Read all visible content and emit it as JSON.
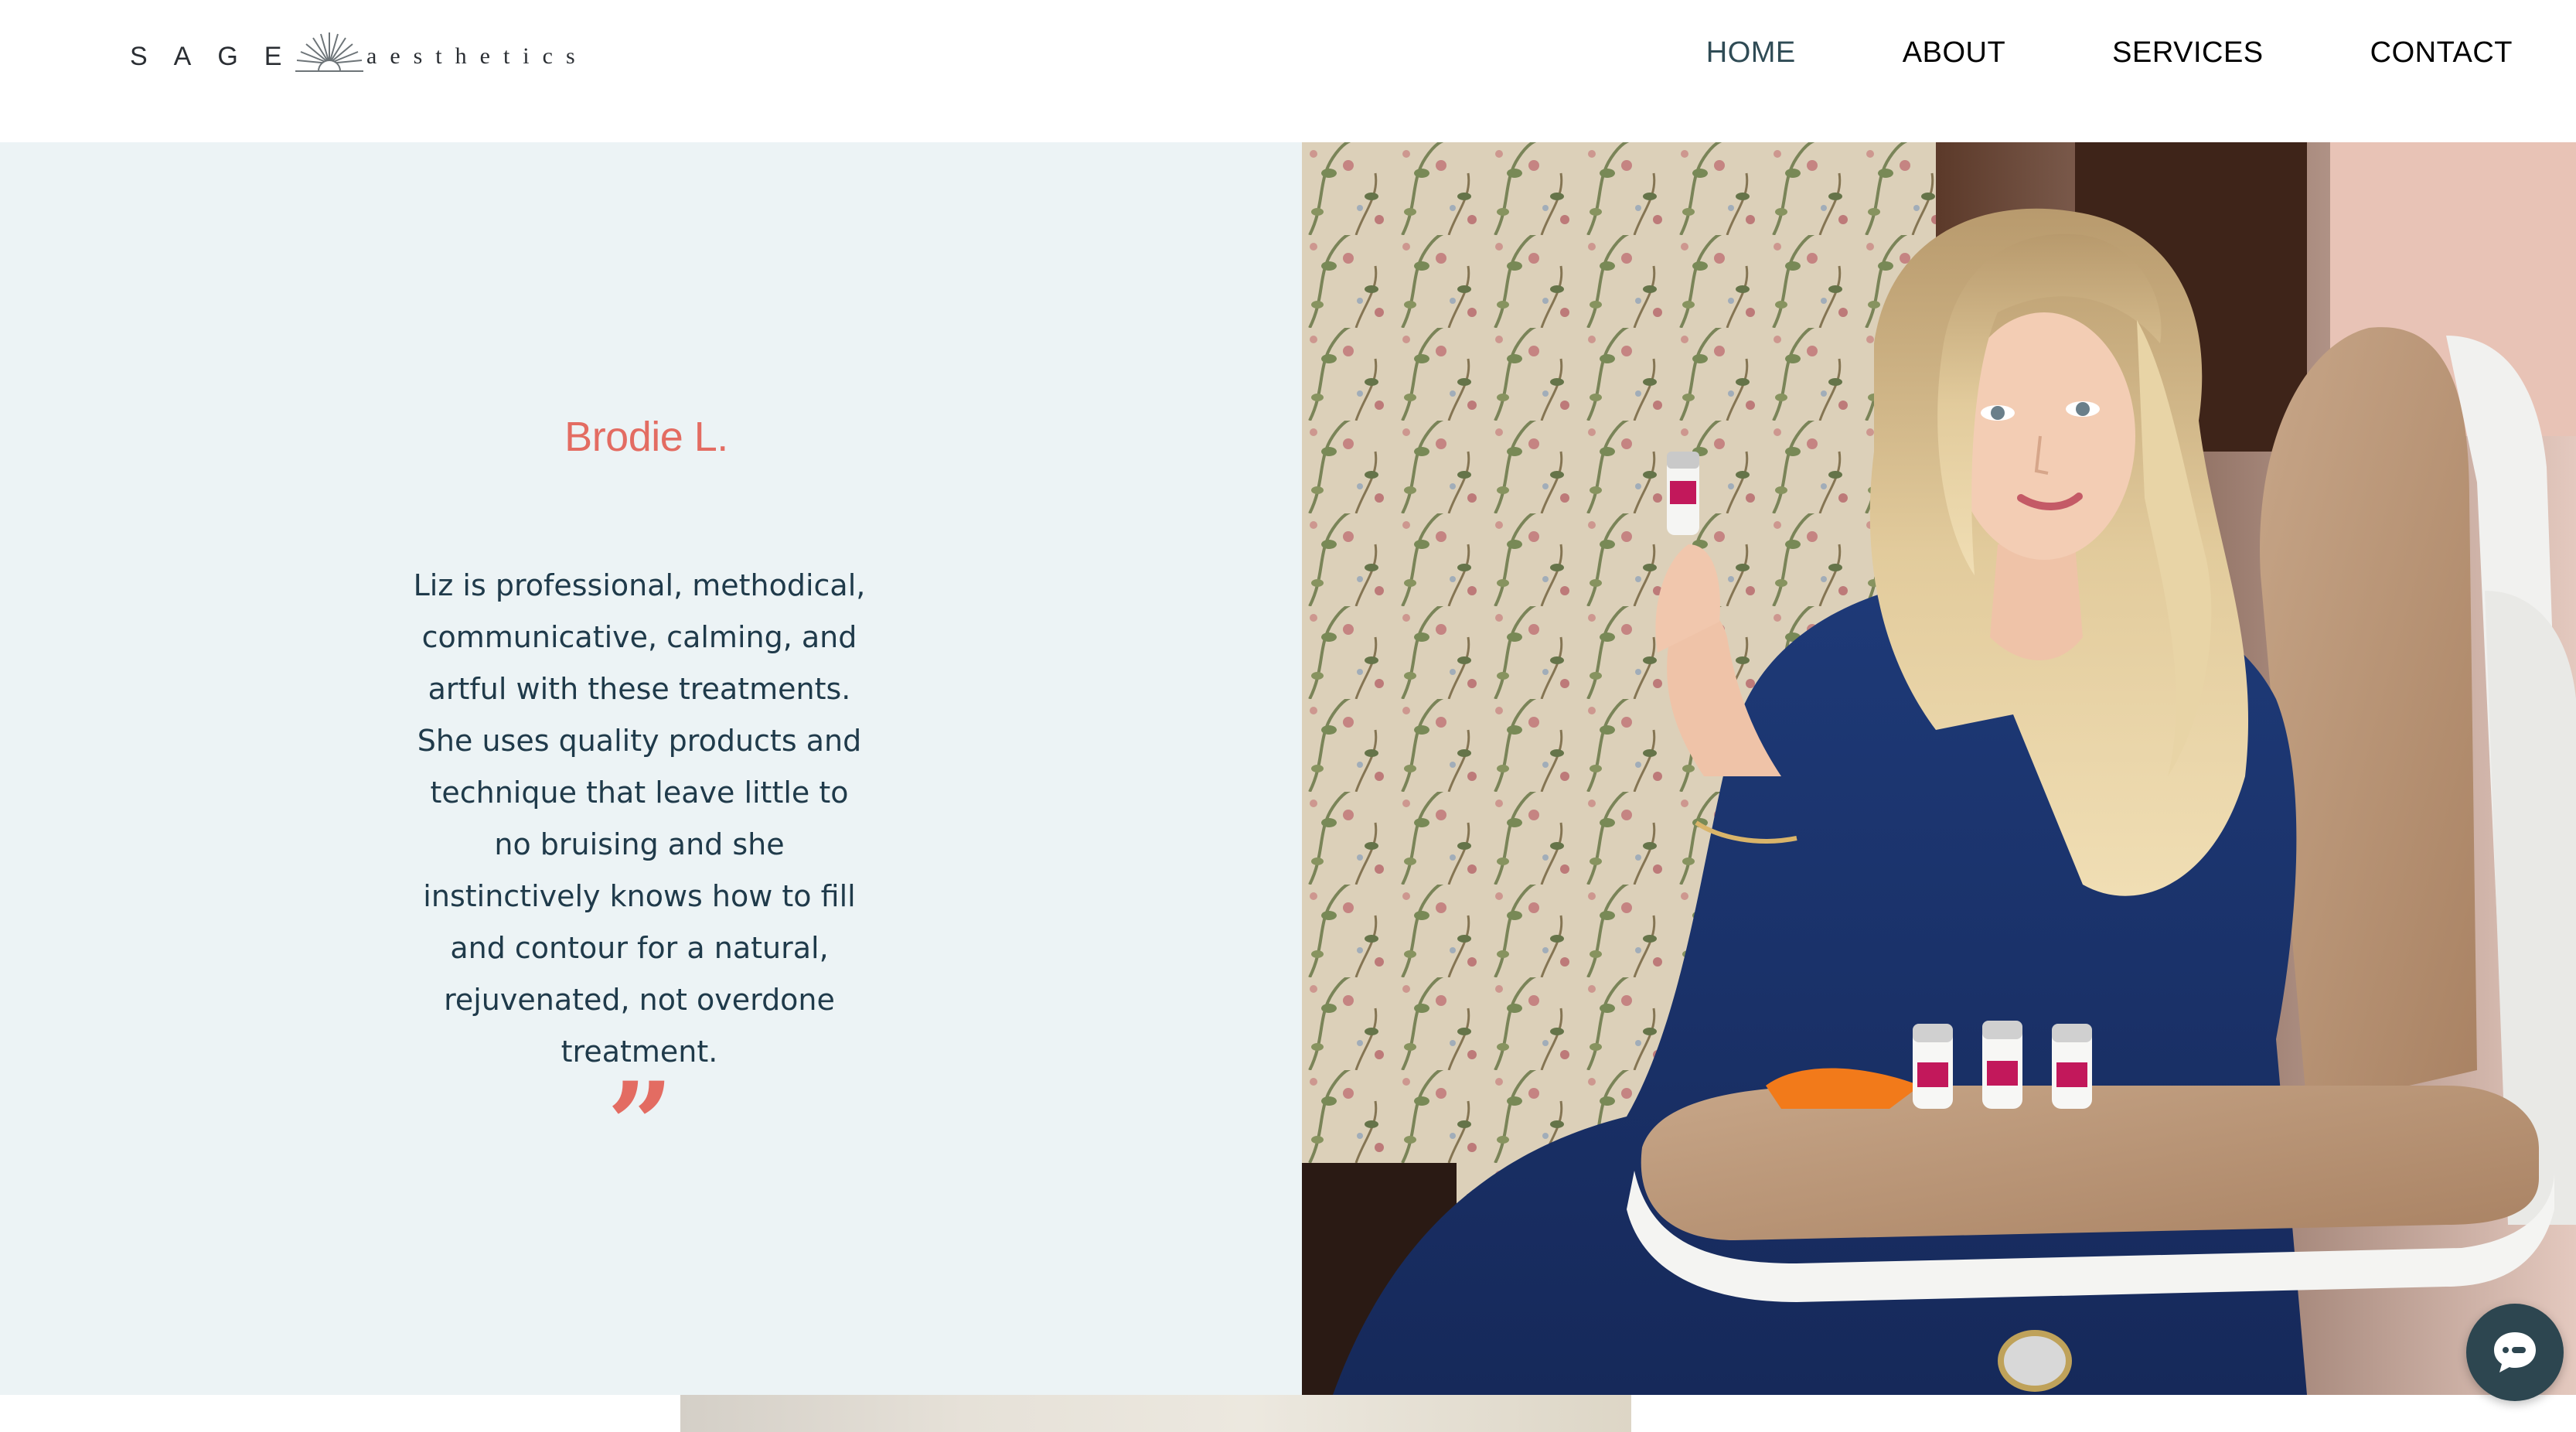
{
  "header": {
    "logo": {
      "word_left": "SAGE",
      "word_right": "aesthetics"
    },
    "nav": [
      {
        "label": "HOME",
        "active": true
      },
      {
        "label": "ABOUT",
        "active": false
      },
      {
        "label": "SERVICES",
        "active": false
      },
      {
        "label": "CONTACT",
        "active": false
      }
    ]
  },
  "testimonial": {
    "reviewer": "Brodie L.",
    "quote_lines": [
      "Liz is professional, methodical,",
      "communicative, calming, and",
      "artful with these treatments.",
      "She uses quality products and",
      "technique that leave little to",
      "no bruising and she",
      "instinctively knows how to fill",
      "and contour for a natural,",
      "rejuvenated, not overdone",
      "treatment."
    ],
    "quote_mark": "”"
  },
  "hero_photo": {
    "icon": "photo-practitioner-holding-vial"
  },
  "chat": {
    "icon": "chat-bubble-icon"
  },
  "colors": {
    "accent": "#e36c62",
    "text": "#1f3a4a",
    "panel_bg": "#ecf3f5",
    "nav_active": "#2f4b55",
    "chat_bg": "#2d4650"
  }
}
